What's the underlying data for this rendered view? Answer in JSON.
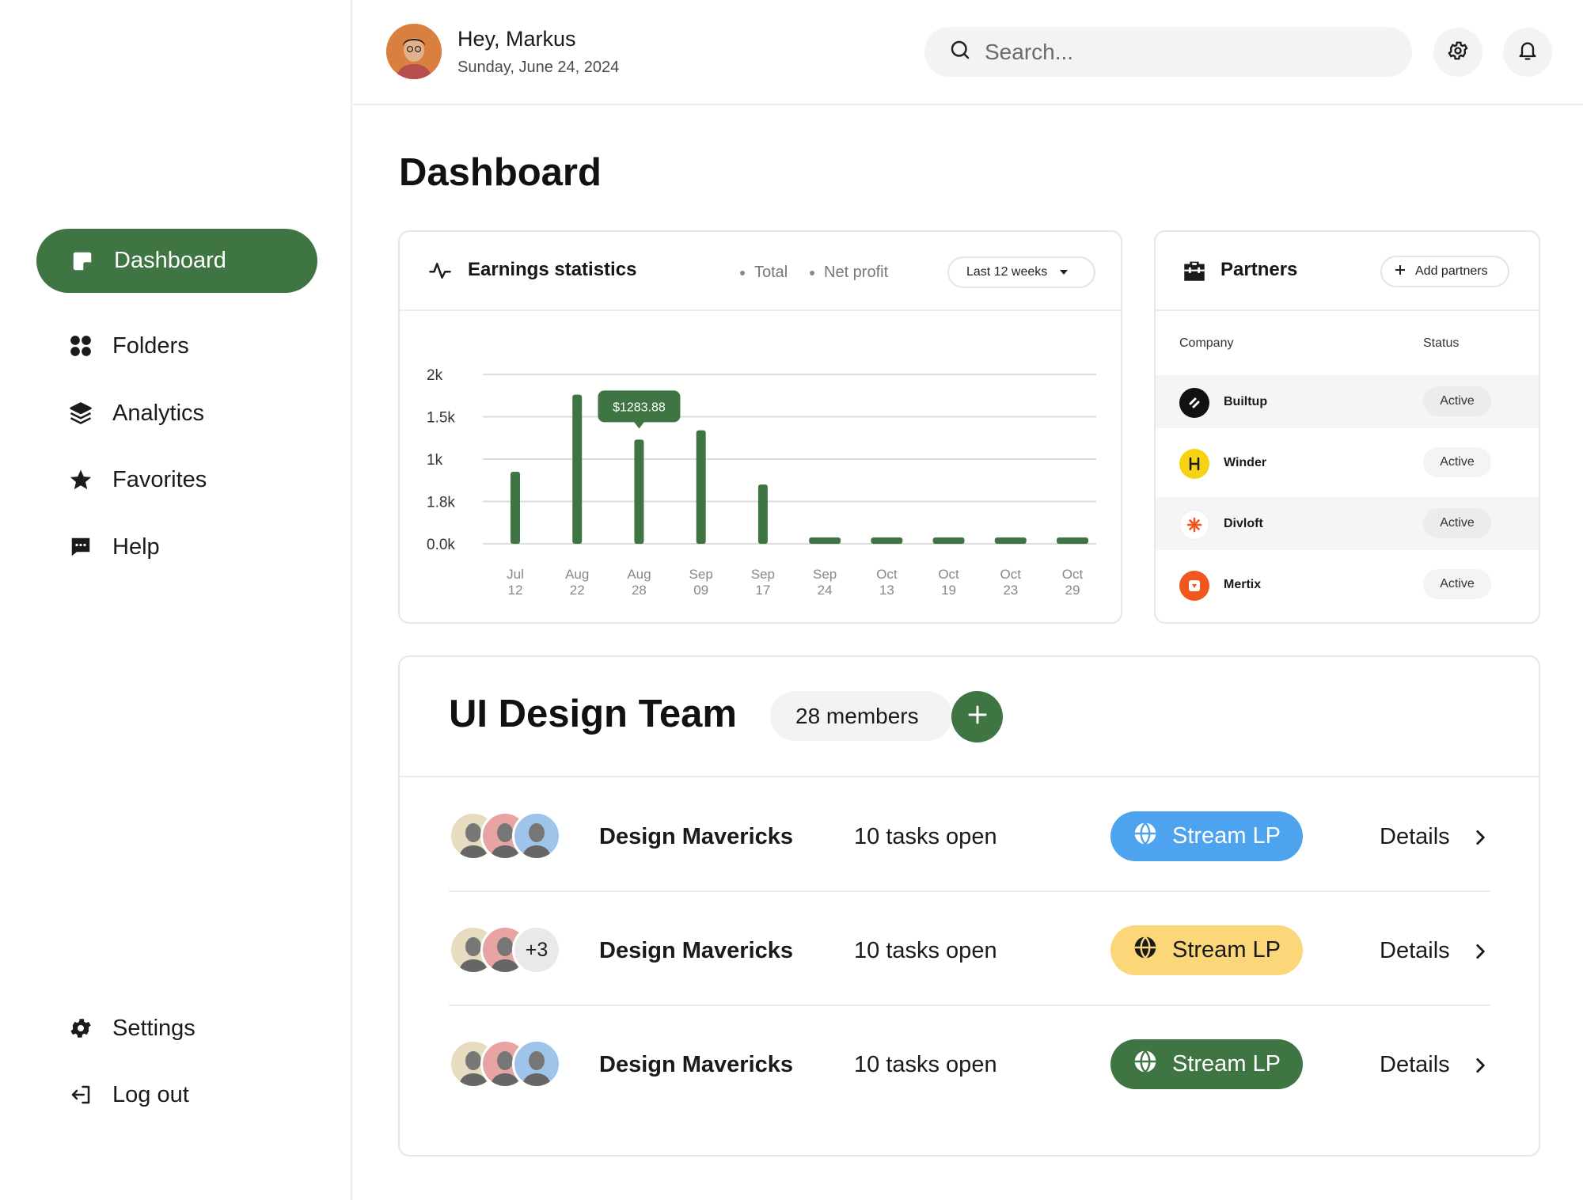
{
  "header": {
    "greeting": "Hey, Markus",
    "date": "Sunday, June 24, 2024",
    "search_placeholder": "Search..."
  },
  "sidebar": {
    "items": [
      {
        "label": "Dashboard",
        "icon": "note-icon",
        "active": true
      },
      {
        "label": "Folders",
        "icon": "grid-icon"
      },
      {
        "label": "Analytics",
        "icon": "layers-icon"
      },
      {
        "label": "Favorites",
        "icon": "star-icon"
      },
      {
        "label": "Help",
        "icon": "chat-icon"
      }
    ],
    "bottom": [
      {
        "label": "Settings",
        "icon": "gear-icon"
      },
      {
        "label": "Log out",
        "icon": "logout-icon"
      }
    ]
  },
  "page": {
    "title": "Dashboard"
  },
  "earnings": {
    "title": "Earnings statistics",
    "legend_total": "Total",
    "legend_net": "Net profit",
    "range": "Last 12 weeks",
    "tooltip": "$1283.88"
  },
  "chart_data": {
    "type": "bar",
    "title": "Earnings statistics",
    "y_tick_labels": [
      "2k",
      "1.5k",
      "1k",
      "1.8k",
      "0.0k"
    ],
    "ylim": [
      0,
      2000
    ],
    "categories": [
      [
        "Jul",
        "12"
      ],
      [
        "Aug",
        "22"
      ],
      [
        "Aug",
        "28"
      ],
      [
        "Sep",
        "09"
      ],
      [
        "Sep",
        "17"
      ],
      [
        "Sep",
        "24"
      ],
      [
        "Oct",
        "13"
      ],
      [
        "Oct",
        "19"
      ],
      [
        "Oct",
        "23"
      ],
      [
        "Oct",
        "29"
      ]
    ],
    "values": [
      850,
      1760,
      1230,
      1340,
      700,
      50,
      50,
      50,
      50,
      50
    ],
    "highlight_index": 2,
    "bar_color": "#3f7443",
    "grid": true
  },
  "partners": {
    "title": "Partners",
    "add_label": "Add partners",
    "col_company": "Company",
    "col_status": "Status",
    "rows": [
      {
        "name": "Builtup",
        "status": "Active",
        "logo_color": "#111111"
      },
      {
        "name": "Winder",
        "status": "Active",
        "logo_color": "#f5d312"
      },
      {
        "name": "Divloft",
        "status": "Active",
        "logo_color": "#ffffff"
      },
      {
        "name": "Mertix",
        "status": "Active",
        "logo_color": "#f0561d"
      }
    ]
  },
  "team": {
    "title": "UI Design Team",
    "members": "28 members",
    "rows": [
      {
        "name": "Design Mavericks",
        "tasks": "10 tasks open",
        "stream": "Stream LP",
        "details": "Details",
        "more": "",
        "stream_bg": "#4da3ee",
        "stream_fg": "#ffffff"
      },
      {
        "name": "Design Mavericks",
        "tasks": "10 tasks open",
        "stream": "Stream LP",
        "details": "Details",
        "more": "+3",
        "stream_bg": "#fbd77a",
        "stream_fg": "#1a1a1a"
      },
      {
        "name": "Design Mavericks",
        "tasks": "10 tasks open",
        "stream": "Stream LP",
        "details": "Details",
        "more": "",
        "stream_bg": "#3f7443",
        "stream_fg": "#ffffff"
      }
    ]
  },
  "colors": {
    "accent": "#3f7443"
  }
}
